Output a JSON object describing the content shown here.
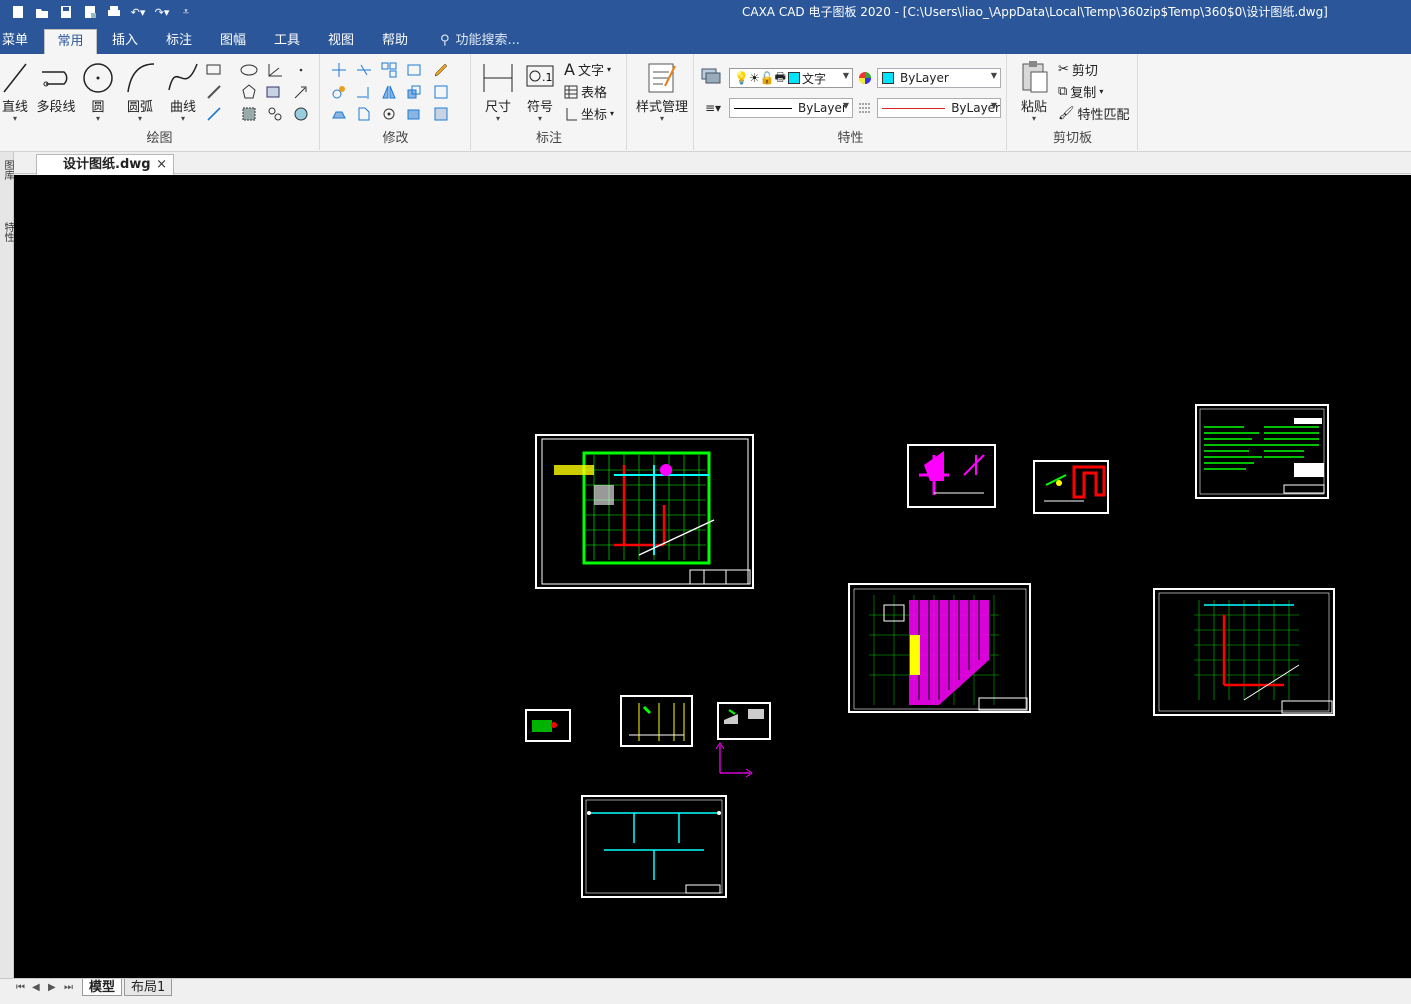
{
  "window": {
    "title": "CAXA CAD 电子图板 2020 - [C:\\Users\\liao_\\AppData\\Local\\Temp\\360zip$Temp\\360$0\\设计图纸.dwg]"
  },
  "ribbon_tabs": [
    "菜单",
    "常用",
    "插入",
    "标注",
    "图幅",
    "工具",
    "视图",
    "帮助"
  ],
  "active_tab": "常用",
  "search": {
    "placeholder": "功能搜索..."
  },
  "groups": {
    "draw": {
      "label": "绘图",
      "line": "直线",
      "polyline": "多段线",
      "circle": "圆",
      "arc": "圆弧",
      "curve": "曲线"
    },
    "modify": {
      "label": "修改"
    },
    "annotate": {
      "label": "标注",
      "dimension": "尺寸",
      "symbol": "符号",
      "text": "文字",
      "table": "表格",
      "coord": "坐标"
    },
    "style": {
      "label": "样式管理"
    },
    "properties": {
      "label": "特性",
      "text_style": "文字",
      "color": "ByLayer",
      "linetype": "ByLayer",
      "lineweight": "ByLayer"
    },
    "clipboard": {
      "label": "剪切板",
      "paste": "粘贴",
      "cut": "剪切",
      "copy": "复制",
      "match": "特性匹配"
    }
  },
  "doc_tab": {
    "label": "设计图纸.dwg",
    "close": "×"
  },
  "left_panel": {
    "item1": "图库",
    "item2": "特性"
  },
  "status": {
    "tab_model": "模型",
    "tab_layout": "布局1"
  },
  "colors": {
    "accent": "#2b579a",
    "canvas": "#000000"
  }
}
